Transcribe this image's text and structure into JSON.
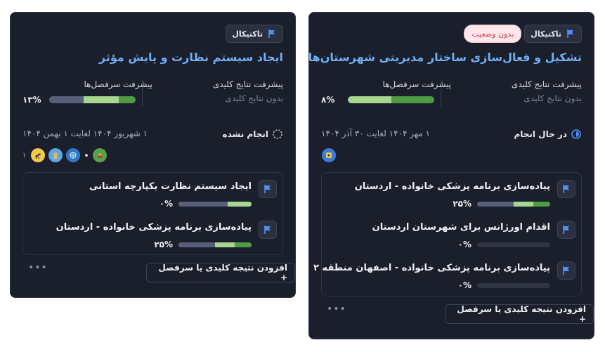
{
  "cards": [
    {
      "tag": "تاکتیکال",
      "status_chip": "",
      "title": "ایجاد سیستم نظارت و پایش مؤثر",
      "kr_label": "پیشرفت نتایج کلیدی",
      "kr_value": "بدون نتایج کلیدی",
      "ch_label": "پیشرفت سرفصل‌ها",
      "ch_percent": "۱۳%",
      "state": "انجام نشده",
      "dates": "۱ شهریور ۱۴۰۴ لغایت ۱ بهمن ۱۴۰۴",
      "avatar_count": "۱",
      "items": [
        {
          "name": "ایجاد سیستم نظارت یکپارچه استانی",
          "percent": "۰%",
          "progress": 0.0
        },
        {
          "name": "پیاده‌سازی برنامه پزشکی خانواده - اردستان",
          "percent": "۲۵%",
          "progress": 0.25
        }
      ],
      "add_label": "افزودن نتیجه کلیدی یا سرفصل +"
    },
    {
      "tag": "تاکتیکال",
      "status_chip": "بدون وضعیت",
      "title": "تشکیل و فعال‌سازی ساختار مدیریتی شهرستان‌ها",
      "kr_label": "پیشرفت نتایج کلیدی",
      "kr_value": "بدون نتایج کلیدی",
      "ch_label": "پیشرفت سرفصل‌ها",
      "ch_percent": "۸%",
      "state": "در حال انجام",
      "dates": "۱ مهر ۱۴۰۴ لغایت ۳۰ آذر ۱۴۰۴",
      "avatar_count": "",
      "items": [
        {
          "name": "پیاده‌سازی برنامه پزشکی خانواده - اردستان",
          "percent": "۲۵%",
          "progress": 0.25
        },
        {
          "name": "اقدام اورژانس برای شهرستان اردستان",
          "percent": "۰%",
          "progress": 0.0
        },
        {
          "name": "پیاده‌سازی برنامه پزشکی خانواده - اصفهان منطقه ۲",
          "percent": "۰%",
          "progress": 0.0
        }
      ],
      "add_label": "افزودن نتیجه کلیدی یا سرفصل +"
    }
  ],
  "colors": {
    "card_bg": "#1b1f2b",
    "title": "#6fb0f5",
    "bar_track": "#2f3545",
    "bar_slate": "#56607a",
    "bar_light_green": "#a6d68f",
    "bar_green": "#4f9c45",
    "flag": "#4f8ff7",
    "status_chip_bg": "#fde7ea",
    "status_chip_text": "#c2414f"
  },
  "icons": {
    "tag": "flag-icon",
    "item": "flag-icon",
    "state_left": "dashed-circle-icon",
    "state_right": "half-circle-icon",
    "more": "ellipsis-icon"
  }
}
